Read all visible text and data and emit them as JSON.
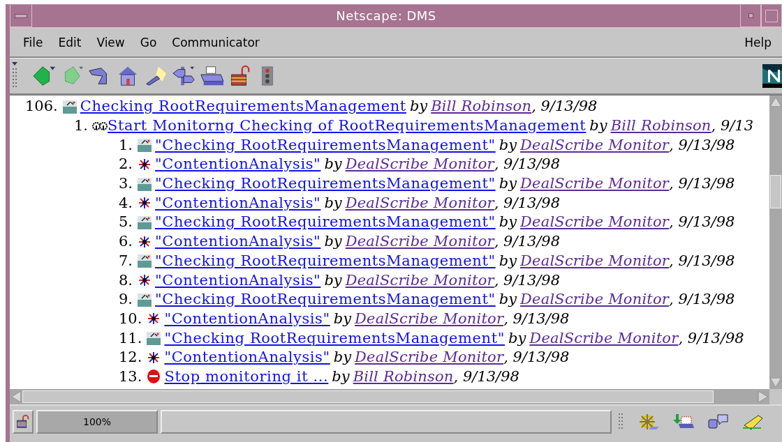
{
  "window": {
    "title": "Netscape: DMS"
  },
  "menu": [
    {
      "label": "File"
    },
    {
      "label": "Edit"
    },
    {
      "label": "View"
    },
    {
      "label": "Go"
    },
    {
      "label": "Communicator"
    }
  ],
  "help_menu": {
    "label": "Help"
  },
  "messages": [
    {
      "number": "106.",
      "kind": "check",
      "title": "Checking RootRequirementsManagement",
      "by": "by",
      "author": "Bill Robinson",
      "date": ", 9/13/98",
      "children": [
        {
          "number": "1.",
          "kind": "start",
          "title": "Start Monitorng Checking of RootRequirementsManagement",
          "by": "by",
          "author": "Bill Robinson",
          "date": ", 9/13",
          "children": [
            {
              "number": "1.",
              "kind": "check",
              "title": "\"Checking RootRequirementsManagement\"",
              "by": "by",
              "author": "DealScribe Monitor",
              "date": ", 9/13/98"
            },
            {
              "number": "2.",
              "kind": "contention",
              "title": "\"ContentionAnalysis\"",
              "by": "by",
              "author": "DealScribe Monitor",
              "date": ", 9/13/98"
            },
            {
              "number": "3.",
              "kind": "check",
              "title": "\"Checking RootRequirementsManagement\"",
              "by": "by",
              "author": "DealScribe Monitor",
              "date": ", 9/13/98"
            },
            {
              "number": "4.",
              "kind": "contention",
              "title": "\"ContentionAnalysis\"",
              "by": "by",
              "author": "DealScribe Monitor",
              "date": ", 9/13/98"
            },
            {
              "number": "5.",
              "kind": "check",
              "title": "\"Checking RootRequirementsManagement\"",
              "by": "by",
              "author": "DealScribe Monitor",
              "date": ", 9/13/98"
            },
            {
              "number": "6.",
              "kind": "contention",
              "title": "\"ContentionAnalysis\"",
              "by": "by",
              "author": "DealScribe Monitor",
              "date": ", 9/13/98"
            },
            {
              "number": "7.",
              "kind": "check",
              "title": "\"Checking RootRequirementsManagement\"",
              "by": "by",
              "author": "DealScribe Monitor",
              "date": ", 9/13/98"
            },
            {
              "number": "8.",
              "kind": "contention",
              "title": "\"ContentionAnalysis\"",
              "by": "by",
              "author": "DealScribe Monitor",
              "date": ", 9/13/98"
            },
            {
              "number": "9.",
              "kind": "check",
              "title": "\"Checking RootRequirementsManagement\"",
              "by": "by",
              "author": "DealScribe Monitor",
              "date": ", 9/13/98"
            },
            {
              "number": "10.",
              "kind": "contention",
              "title": "\"ContentionAnalysis\"",
              "by": "by",
              "author": "DealScribe Monitor",
              "date": ", 9/13/98"
            },
            {
              "number": "11.",
              "kind": "check",
              "title": "\"Checking RootRequirementsManagement\"",
              "by": "by",
              "author": "DealScribe Monitor",
              "date": ", 9/13/98"
            },
            {
              "number": "12.",
              "kind": "contention",
              "title": "\"ContentionAnalysis\"",
              "by": "by",
              "author": "DealScribe Monitor",
              "date": ", 9/13/98"
            },
            {
              "number": "13.",
              "kind": "stop",
              "title": "Stop monitoring it ...",
              "by": "by",
              "author": "Bill Robinson",
              "date": ", 9/13/98"
            }
          ]
        }
      ]
    }
  ],
  "status_bar": {
    "zoom": "100%"
  }
}
